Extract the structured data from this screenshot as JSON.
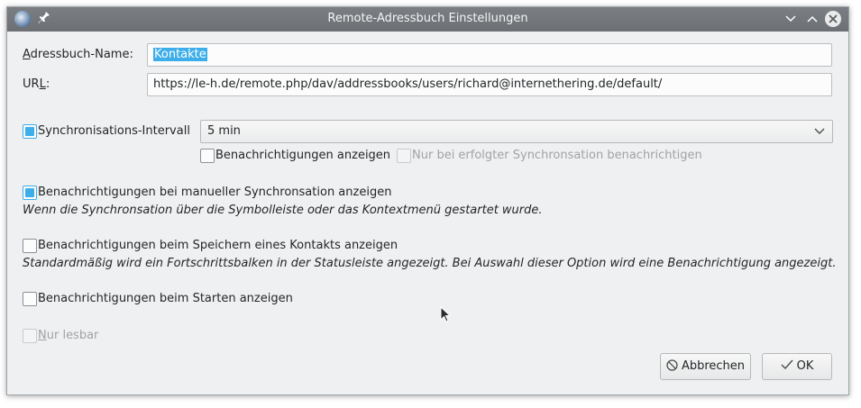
{
  "window": {
    "title": "Remote-Adressbuch Einstellungen",
    "controls": {
      "minimize": "∨",
      "maximize": "∧",
      "close": "✕"
    }
  },
  "fields": {
    "name_label_first": "A",
    "name_label_rest": "dressbuch-Name:",
    "name_value": "Kontakte",
    "url_label_first": "UR",
    "url_label_underlined": "L",
    "url_label_rest": ":",
    "url_value": "https://le-h.de/remote.php/dav/addressbooks/users/richard@internethering.de/default/"
  },
  "sync": {
    "label": "Synchronisations-Intervall",
    "checked": true,
    "interval_value": "5 min",
    "notify_label": "Benachrichtigungen anzeigen",
    "notify_checked": false,
    "only_success_label": "Nur bei erfolgter Synchronsation benachrichtigen",
    "only_success_enabled": false
  },
  "options": {
    "manual_label": "Benachrichtigungen bei manueller Synchronsation anzeigen",
    "manual_checked": true,
    "manual_note": "Wenn die Synchronsation über die Symbolleiste oder das Kontextmenü gestartet wurde.",
    "save_label": "Benachrichtigungen beim Speichern eines Kontakts anzeigen",
    "save_checked": false,
    "save_note": "Standardmäßig wird ein Fortschrittsbalken in der Statusleiste angezeigt. Bei Auswahl dieser Option wird eine Benachrichtigung angezeigt.",
    "start_label": "Benachrichtigungen beim Starten anzeigen",
    "start_checked": false,
    "readonly_label_first": "N",
    "readonly_label_rest": "ur lesbar",
    "readonly_enabled": false
  },
  "buttons": {
    "cancel_label": "Abbrechen",
    "ok_label": "OK"
  },
  "colors": {
    "accent": "#3daee9",
    "titlebar": "#757a7e",
    "window_bg": "#eff0f1"
  }
}
